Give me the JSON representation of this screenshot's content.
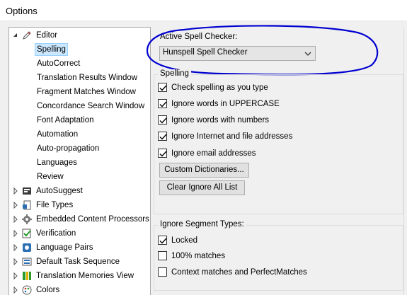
{
  "window": {
    "title": "Options"
  },
  "tree": {
    "items": [
      {
        "label": "Editor",
        "icon": "pencil-icon",
        "expanded": true
      },
      {
        "label": "Spelling",
        "selected": true
      },
      {
        "label": "AutoCorrect"
      },
      {
        "label": "Translation Results Window"
      },
      {
        "label": "Fragment Matches Window"
      },
      {
        "label": "Concordance Search Window"
      },
      {
        "label": "Font Adaptation"
      },
      {
        "label": "Automation"
      },
      {
        "label": "Auto-propagation"
      },
      {
        "label": "Languages"
      },
      {
        "label": "Review"
      },
      {
        "label": "AutoSuggest",
        "icon": "autosuggest-icon"
      },
      {
        "label": "File Types",
        "icon": "file-types-icon"
      },
      {
        "label": "Embedded Content Processors",
        "icon": "gear-icon"
      },
      {
        "label": "Verification",
        "icon": "verification-icon"
      },
      {
        "label": "Language Pairs",
        "icon": "language-pairs-icon"
      },
      {
        "label": "Default Task Sequence",
        "icon": "task-sequence-icon"
      },
      {
        "label": "Translation Memories View",
        "icon": "translation-memories-icon"
      },
      {
        "label": "Colors",
        "icon": "palette-icon"
      }
    ]
  },
  "spell_checker": {
    "label": "Active Spell Checker:",
    "selected": "Hunspell Spell Checker"
  },
  "spelling": {
    "title": "Spelling",
    "options": [
      {
        "label": "Check spelling as you type",
        "checked": true
      },
      {
        "label": "Ignore words in UPPERCASE",
        "checked": true
      },
      {
        "label": "Ignore words with numbers",
        "checked": true
      },
      {
        "label": "Ignore Internet and file addresses",
        "checked": true
      },
      {
        "label": "Ignore email addresses",
        "checked": true
      }
    ],
    "custom_dictionaries_button": "Custom Dictionaries...",
    "clear_ignore_button": "Clear Ignore All List"
  },
  "ignore_segment": {
    "title": "Ignore Segment Types:",
    "options": [
      {
        "label": "Locked",
        "checked": true
      },
      {
        "label": "100% matches",
        "checked": false
      },
      {
        "label": "Context matches and PerfectMatches",
        "checked": false
      }
    ]
  },
  "colors": {
    "ink": "#0000d0",
    "selection": "#cce8ff"
  }
}
